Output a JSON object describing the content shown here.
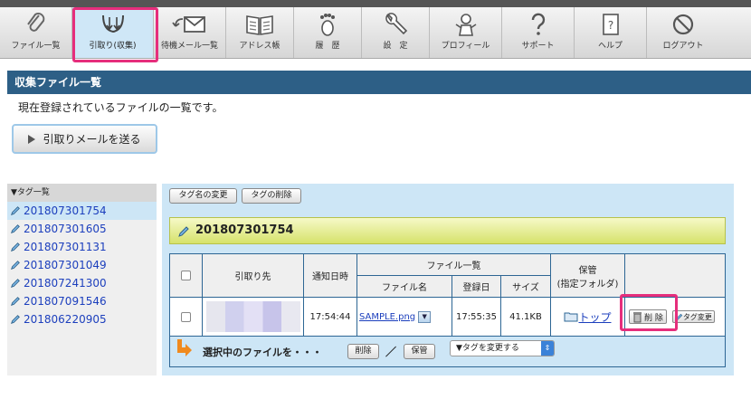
{
  "toolbar": {
    "items": [
      {
        "label": "ファイル一覧",
        "icon": "paperclip-icon"
      },
      {
        "label": "引取り(収集)",
        "icon": "collect-icon"
      },
      {
        "label": "待機メール一覧",
        "icon": "waiting-mail-icon"
      },
      {
        "label": "アドレス帳",
        "icon": "address-book-icon"
      },
      {
        "label": "履　歴",
        "icon": "footprint-icon"
      },
      {
        "label": "設　定",
        "icon": "wrench-icon"
      },
      {
        "label": "プロフィール",
        "icon": "profile-icon"
      },
      {
        "label": "サポート",
        "icon": "question-icon"
      },
      {
        "label": "ヘルプ",
        "icon": "help-book-icon"
      },
      {
        "label": "ログアウト",
        "icon": "logout-icon"
      }
    ],
    "active_index": 1
  },
  "page": {
    "title": "収集ファイル一覧",
    "description": "現在登録されているファイルの一覧です。",
    "send_button": "引取りメールを送る"
  },
  "sidebar": {
    "header": "▼タグ一覧",
    "tags": [
      "201807301754",
      "201807301605",
      "201807301131",
      "201807301049",
      "201807241300",
      "201807091546",
      "201806220905"
    ],
    "selected_index": 0
  },
  "panel": {
    "rename_tag_button": "タグ名の変更",
    "delete_tag_button": "タグの削除",
    "current_tag": "201807301754"
  },
  "table": {
    "headers": {
      "source": "引取り先",
      "notify_time": "通知日時",
      "file_list": "ファイル一覧",
      "file_name": "ファイル名",
      "registered": "登録日",
      "size": "サイズ",
      "storage": "保管",
      "storage_sub": "(指定フォルダ)"
    },
    "rows": [
      {
        "notify_time": "17:54:44",
        "file_name": "SAMPLE.png",
        "registered": "17:55:35",
        "size": "41.1KB",
        "folder": "トップ",
        "delete_label": "削 除",
        "tag_change_label": "タグ変更"
      }
    ]
  },
  "footer": {
    "selected_text": "選択中のファイルを・・・",
    "delete_button": "削除",
    "separator": "／",
    "keep_button": "保管",
    "tag_select": "▼タグを変更する"
  },
  "colors": {
    "accent_navy": "#2d5f86",
    "highlight_pink": "#e62e7c",
    "link_blue": "#1c3fbd",
    "panel_blue": "#cde6f6"
  }
}
